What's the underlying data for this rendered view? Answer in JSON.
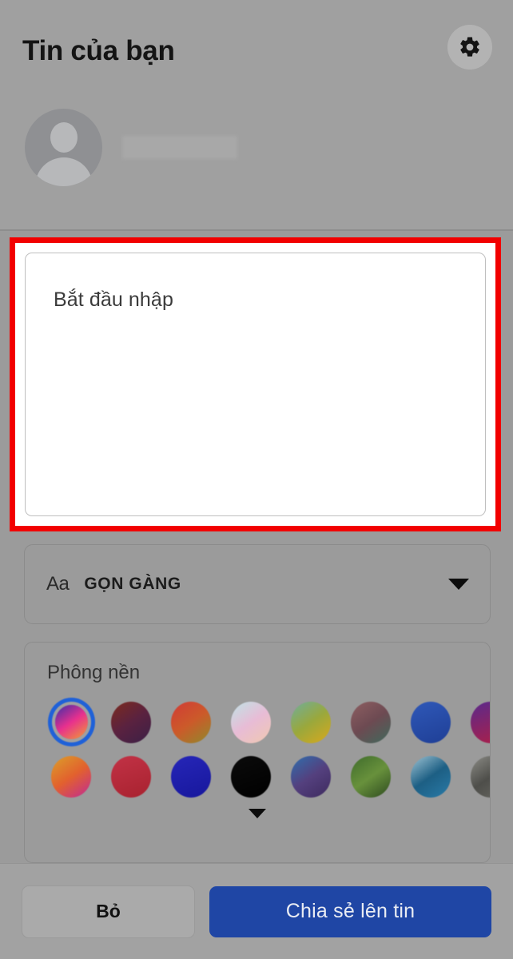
{
  "header": {
    "title": "Tin của bạn",
    "settings_icon": "gear-icon",
    "avatar_icon": "default-avatar-icon",
    "user_name": ""
  },
  "composer": {
    "placeholder": "Bắt đầu nhập",
    "value": "",
    "annotation_color": "#f20000"
  },
  "font_selector": {
    "icon_label": "Aa",
    "selected_font": "GỌN GÀNG",
    "chevron_icon": "chevron-down-icon"
  },
  "background_section": {
    "label": "Phông nền",
    "expand_icon": "chevron-down-icon",
    "selected_index": 0,
    "swatches": [
      {
        "name": "blue-magenta-swirl",
        "colors": [
          "#3a2fa8",
          "#e8308e",
          "#f0a030",
          "#2e3fbf"
        ],
        "selected": true
      },
      {
        "name": "dark-maroon-purple",
        "colors": [
          "#7d2b1e",
          "#5a2240",
          "#3b2046"
        ],
        "selected": false
      },
      {
        "name": "red-orange-olive",
        "colors": [
          "#d23a36",
          "#cc5a2a",
          "#8f8a2c"
        ],
        "selected": false
      },
      {
        "name": "pastel-pink-cyan",
        "colors": [
          "#bfe4e6",
          "#e8bcd6",
          "#f0c9b0"
        ],
        "selected": false
      },
      {
        "name": "teal-yellow-gradient",
        "colors": [
          "#6fae9b",
          "#9aa83c",
          "#d9a81c"
        ],
        "selected": false
      },
      {
        "name": "mauve-teal-gradient",
        "colors": [
          "#8e5f62",
          "#6d4a52",
          "#3f6a5c"
        ],
        "selected": false
      },
      {
        "name": "royal-blue",
        "colors": [
          "#2f58b8",
          "#1f3f96"
        ],
        "selected": false
      },
      {
        "name": "purple-crimson",
        "colors": [
          "#5a2a8c",
          "#b01f45"
        ],
        "selected": false
      },
      {
        "name": "orange-magenta",
        "colors": [
          "#dba02a",
          "#e2612e",
          "#c02a96"
        ],
        "selected": false
      },
      {
        "name": "crimson-red",
        "colors": [
          "#c23246",
          "#a8222f"
        ],
        "selected": false
      },
      {
        "name": "deep-blue",
        "colors": [
          "#2626b8",
          "#17179c"
        ],
        "selected": false
      },
      {
        "name": "black",
        "colors": [
          "#0b0b0b",
          "#000000"
        ],
        "selected": false
      },
      {
        "name": "blue-purple-nebula",
        "colors": [
          "#2f6fae",
          "#54407e",
          "#3d2a5e"
        ],
        "selected": false
      },
      {
        "name": "green-foliage",
        "colors": [
          "#3e6b2c",
          "#68913c",
          "#2d4a1f"
        ],
        "selected": false
      },
      {
        "name": "ocean-blue",
        "colors": [
          "#9fc4d4",
          "#1d5f84",
          "#2a7ba8"
        ],
        "selected": false
      },
      {
        "name": "grey-stone",
        "colors": [
          "#8c8c86",
          "#4e4e4a",
          "#6a6a64"
        ],
        "selected": false
      }
    ]
  },
  "bottom_bar": {
    "dismiss_label": "Bỏ",
    "share_label": "Chia sẻ lên tin",
    "share_color": "#1f46a5"
  }
}
